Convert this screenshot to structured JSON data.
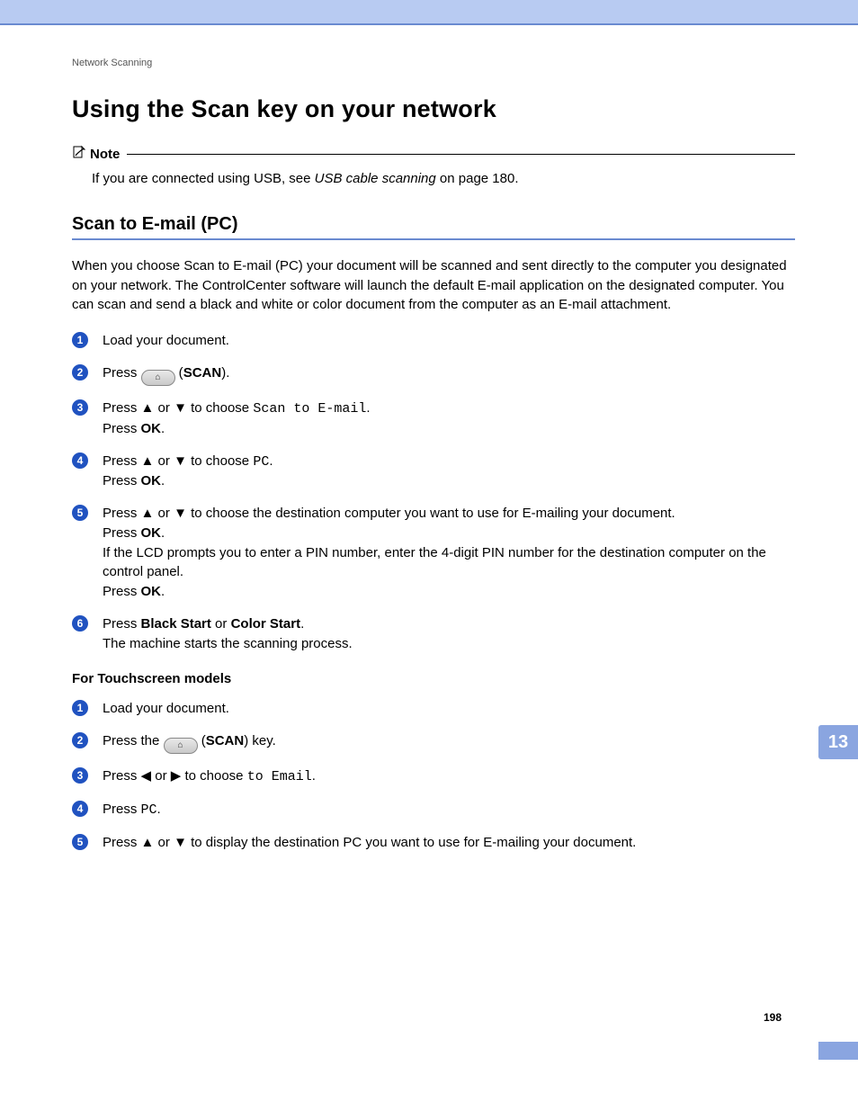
{
  "runningHeader": "Network Scanning",
  "h1": "Using the Scan key on your network",
  "note": {
    "label": "Note",
    "prefix": "If you are connected using USB, see ",
    "xref": "USB cable scanning",
    "suffix": " on page 180."
  },
  "h2": "Scan to E-mail (PC)",
  "intro": "When you choose Scan to E-mail (PC) your document will be scanned and sent directly to the computer you designated on your network. The ControlCenter software will launch the default E-mail application on the designated computer. You can scan and send a black and white or color document from the computer as an E-mail attachment.",
  "steps": {
    "s1": "Load your document.",
    "s2": {
      "a": "Press ",
      "b": " (",
      "c": "SCAN",
      "d": ")."
    },
    "s3": {
      "a": "Press ",
      "up": "▲",
      "or": " or ",
      "dn": "▼",
      "b": " to choose ",
      "mono": "Scan to E-mail",
      "c": ".",
      "line2a": "Press ",
      "ok": "OK",
      "line2b": "."
    },
    "s4": {
      "a": "Press ",
      "up": "▲",
      "or": " or ",
      "dn": "▼",
      "b": " to choose ",
      "mono": "PC",
      "c": ".",
      "line2a": "Press ",
      "ok": "OK",
      "line2b": "."
    },
    "s5": {
      "a": "Press ",
      "up": "▲",
      "or": " or ",
      "dn": "▼",
      "b": " to choose the destination computer you want to use for E-mailing your document.",
      "l2a": "Press ",
      "ok": "OK",
      "l2b": ".",
      "l3": "If the LCD prompts you to enter a PIN number, enter the 4-digit PIN number for the destination computer on the control panel.",
      "l4a": "Press ",
      "l4b": "."
    },
    "s6": {
      "a": "Press ",
      "b1": "Black Start",
      "or": " or ",
      "b2": "Color Start",
      "c": ".",
      "l2": "The machine starts the scanning process."
    }
  },
  "subhead": "For Touchscreen models",
  "tsteps": {
    "t1": "Load your document.",
    "t2": {
      "a": "Press the ",
      "b": " (",
      "c": "SCAN",
      "d": ") key."
    },
    "t3": {
      "a": "Press ",
      "left": "◀",
      "or": " or ",
      "right": "▶",
      "b": " to choose ",
      "mono": "to Email",
      "c": "."
    },
    "t4": {
      "a": "Press ",
      "mono": "PC",
      "b": "."
    },
    "t5": {
      "a": "Press ",
      "up": "▲",
      "or": " or ",
      "dn": "▼",
      "b": " to display the destination PC you want to use for E-mailing your document."
    }
  },
  "sideTab": "13",
  "pageNumber": "198",
  "glyphs": {
    "scanIcon": "⌂"
  }
}
